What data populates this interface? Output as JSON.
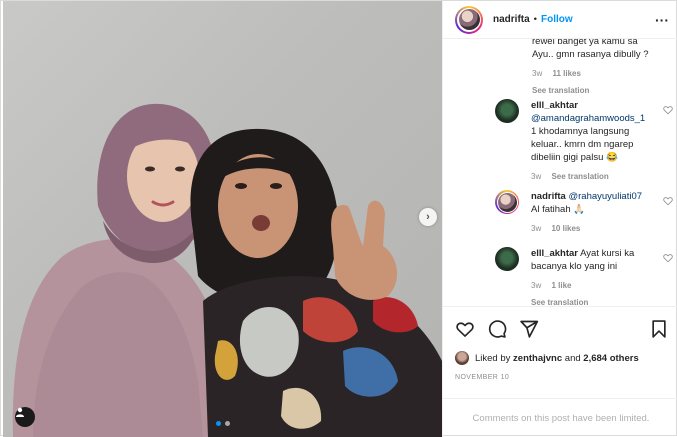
{
  "header": {
    "username": "nadrifta",
    "separator": "•",
    "follow_label": "Follow",
    "more_label": "···"
  },
  "comments": {
    "partial": {
      "text_line1": "rewel banget ya kamu sa",
      "text_line2": "Ayu.. gmn rasanya dibully ?",
      "age": "3w",
      "likes": "11 likes",
      "see_translation": "See translation"
    },
    "items": [
      {
        "username": "elll_akhtar",
        "mention": "@amandagrahamwoods_1",
        "text": "1 khodamnya langsung keluar.. kmrn dm ngarep dibeliin gigi palsu 😂",
        "age": "3w",
        "likes": "",
        "see_translation": "See translation"
      },
      {
        "username": "nadrifta",
        "mention": "@rahayuyuliati07",
        "text": "Al fatihah 🙏🏻",
        "age": "3w",
        "likes": "10 likes",
        "see_translation": ""
      },
      {
        "username": "elll_akhtar",
        "mention": "",
        "text": "Ayat kursi ka bacanya klo yang ini",
        "age": "3w",
        "likes": "1 like",
        "see_translation": "See translation"
      }
    ]
  },
  "likes": {
    "prefix": "Liked by",
    "user": "zenthajvnc",
    "and": "and",
    "count": "2,684 others"
  },
  "date": "NOVEMBER 10",
  "footer": {
    "limited": "Comments on this post have been limited."
  },
  "icons": {
    "like": "heart-icon",
    "comment": "comment-icon",
    "share": "paper-plane-icon",
    "save": "bookmark-icon",
    "next": "chevron-right-icon",
    "tag": "user-tag-icon"
  },
  "colors": {
    "accent": "#0095f6",
    "text": "#262626",
    "muted": "#8e8e8e",
    "mention": "#00376b"
  },
  "carousel": {
    "current": 1,
    "total": 2
  }
}
